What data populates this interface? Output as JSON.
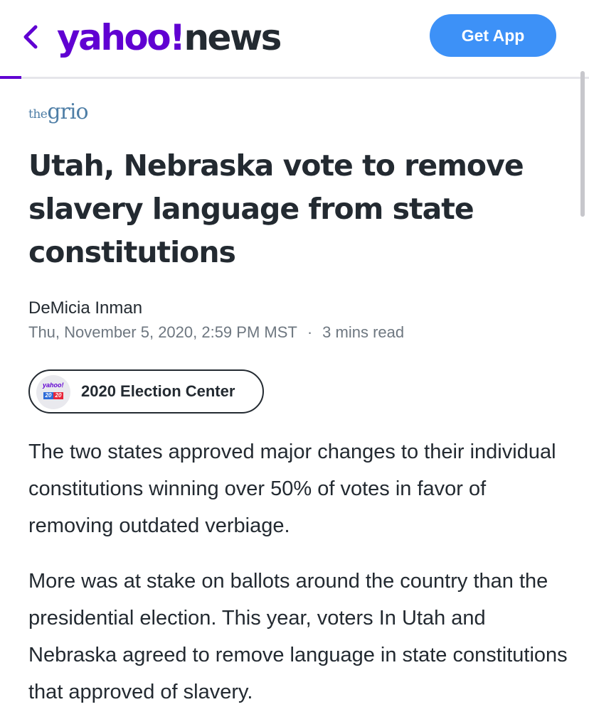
{
  "header": {
    "logo_yahoo": "yahoo",
    "logo_bang": "!",
    "logo_news": "news",
    "get_app_label": "Get App",
    "back_icon": "chevron-left-icon",
    "brand_color": "#6001d2",
    "button_color": "#3d91f7"
  },
  "article": {
    "publisher_the": "the",
    "publisher_name": "grio",
    "headline": "Utah, Nebraska vote to remove slavery language from state constitutions",
    "author": "DeMicia Inman",
    "date": "Thu, November 5, 2020, 2:59 PM MST",
    "separator": "·",
    "read_time": "3 mins read",
    "paragraphs": [
      "The two states approved major changes to their individual constitutions winning over 50% of votes in favor of removing outdated verbiage.",
      "More was at stake on ballots around the country than the presidential election. This year, voters In Utah and Nebraska agreed to remove language in state constitutions that approved of slavery."
    ]
  },
  "election_pill": {
    "label": "2020 Election Center",
    "icon_text": "yahoo!",
    "icon_num_left": "20",
    "icon_num_right": "20"
  }
}
